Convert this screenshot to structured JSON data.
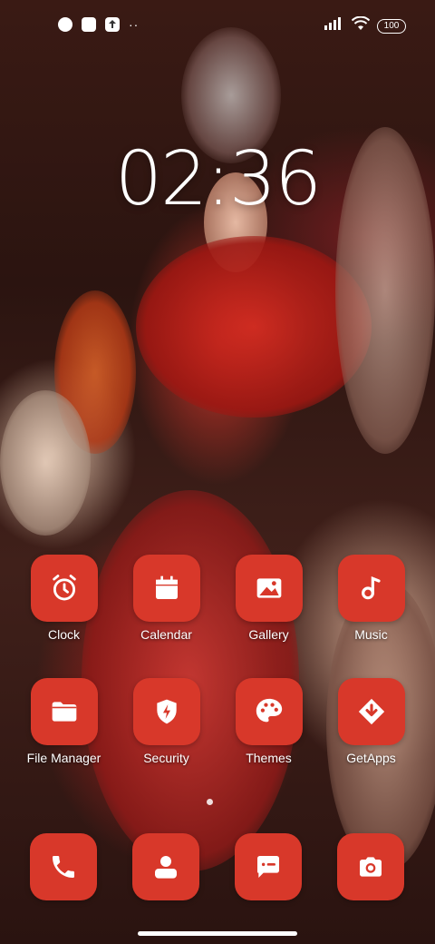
{
  "status_bar": {
    "overflow": "··",
    "battery": "100"
  },
  "clock": {
    "time": "02:36"
  },
  "apps": [
    {
      "label": "Clock",
      "icon": "alarm-clock-icon"
    },
    {
      "label": "Calendar",
      "icon": "calendar-icon"
    },
    {
      "label": "Gallery",
      "icon": "gallery-icon"
    },
    {
      "label": "Music",
      "icon": "music-note-icon"
    },
    {
      "label": "File Manager",
      "icon": "folder-icon"
    },
    {
      "label": "Security",
      "icon": "shield-bolt-icon"
    },
    {
      "label": "Themes",
      "icon": "palette-icon"
    },
    {
      "label": "GetApps",
      "icon": "download-icon"
    }
  ],
  "dock": [
    {
      "icon": "phone-icon"
    },
    {
      "icon": "contacts-icon"
    },
    {
      "icon": "messages-icon"
    },
    {
      "icon": "camera-icon"
    }
  ],
  "colors": {
    "tile": "#d8382a",
    "text": "#ffffff"
  }
}
